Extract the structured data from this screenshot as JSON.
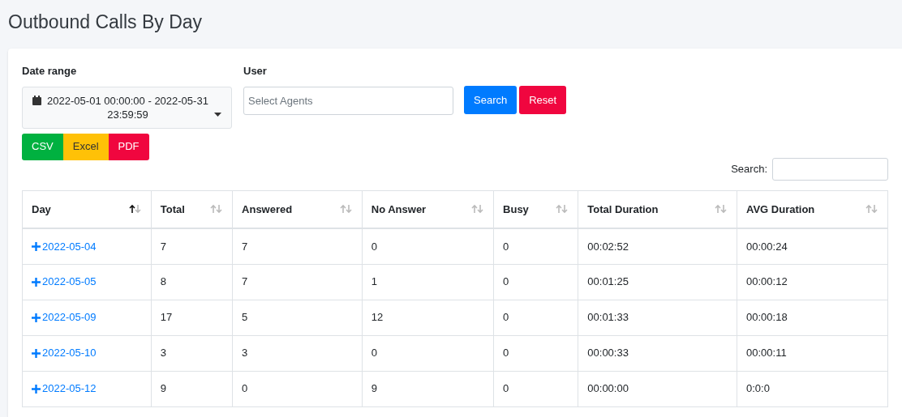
{
  "page_title": "Outbound Calls By Day",
  "filters": {
    "date_range": {
      "label": "Date range",
      "value": "2022-05-01 00:00:00 - 2022-05-31 23:59:59"
    },
    "user": {
      "label": "User",
      "placeholder": "Select Agents"
    },
    "buttons": [
      {
        "label": "Search",
        "kind": "primary"
      },
      {
        "label": "Reset",
        "kind": "danger"
      }
    ]
  },
  "export_buttons": [
    {
      "label": "CSV",
      "kind": "success"
    },
    {
      "label": "Excel",
      "kind": "warning"
    },
    {
      "label": "PDF",
      "kind": "danger"
    }
  ],
  "table_search": {
    "label": "Search:"
  },
  "table": {
    "columns": [
      {
        "label": "Day",
        "sorted": true
      },
      {
        "label": "Total",
        "sorted": false
      },
      {
        "label": "Answered",
        "sorted": false
      },
      {
        "label": "No Answer",
        "sorted": false
      },
      {
        "label": "Busy",
        "sorted": false
      },
      {
        "label": "Total Duration",
        "sorted": false
      },
      {
        "label": "AVG Duration",
        "sorted": false
      }
    ],
    "rows": [
      [
        "2022-05-04",
        "7",
        "7",
        "0",
        "0",
        "00:02:52",
        "00:00:24"
      ],
      [
        "2022-05-05",
        "8",
        "7",
        "1",
        "0",
        "00:01:25",
        "00:00:12"
      ],
      [
        "2022-05-09",
        "17",
        "5",
        "12",
        "0",
        "00:01:33",
        "00:00:18"
      ],
      [
        "2022-05-10",
        "3",
        "3",
        "0",
        "0",
        "00:00:33",
        "00:00:11"
      ],
      [
        "2022-05-12",
        "9",
        "0",
        "9",
        "0",
        "00:00:00",
        "0:0:0"
      ]
    ]
  }
}
